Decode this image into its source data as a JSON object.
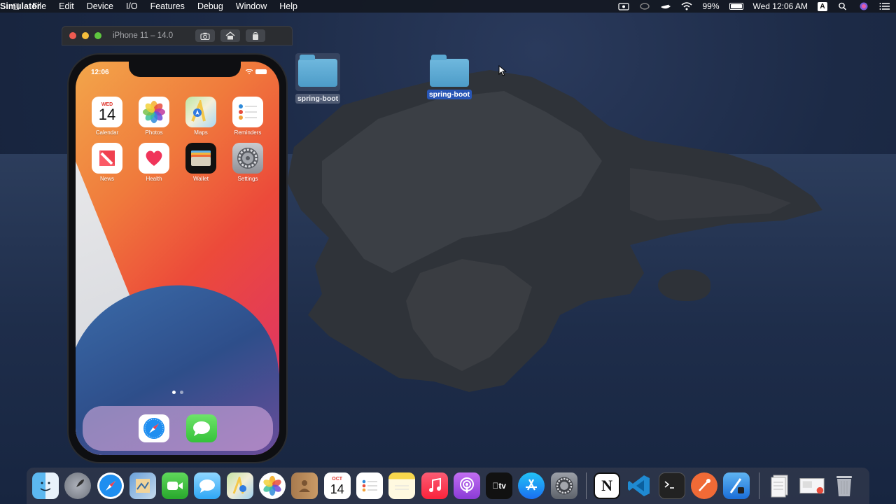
{
  "menubar": {
    "app_name": "Simulator",
    "menus": [
      "File",
      "Edit",
      "Device",
      "I/O",
      "Features",
      "Debug",
      "Window",
      "Help"
    ],
    "battery_percent": "99%",
    "clock": "Wed 12:06 AM",
    "input_source": "A"
  },
  "simulator": {
    "title": "iPhone 11 – 14.0",
    "phone_time": "12:06",
    "calendar_day": "WED",
    "calendar_date": "14",
    "apps": [
      {
        "label": "Calendar",
        "icon": "calendar-icon"
      },
      {
        "label": "Photos",
        "icon": "photos-icon"
      },
      {
        "label": "Maps",
        "icon": "maps-icon"
      },
      {
        "label": "Reminders",
        "icon": "reminders-icon"
      },
      {
        "label": "News",
        "icon": "news-icon"
      },
      {
        "label": "Health",
        "icon": "health-icon"
      },
      {
        "label": "Wallet",
        "icon": "wallet-icon"
      },
      {
        "label": "Settings",
        "icon": "settings-icon"
      }
    ],
    "dock_apps": [
      "safari-icon",
      "messages-icon"
    ]
  },
  "desktop": {
    "icons": [
      {
        "label": "spring-boot",
        "selected": false
      },
      {
        "label": "spring-boot",
        "selected": true
      }
    ]
  },
  "dock": {
    "calendar_month": "OCT",
    "calendar_date": "14",
    "notion_letter": "N",
    "items": [
      "finder",
      "launchpad",
      "safari",
      "preview",
      "facetime",
      "messages",
      "maps",
      "photos",
      "contacts",
      "calendar",
      "reminders",
      "notes",
      "music",
      "podcasts",
      "tv",
      "app-store",
      "system-preferences",
      "notion",
      "vscode",
      "terminal",
      "postman",
      "xcode",
      "documents",
      "downloads",
      "trash"
    ]
  }
}
